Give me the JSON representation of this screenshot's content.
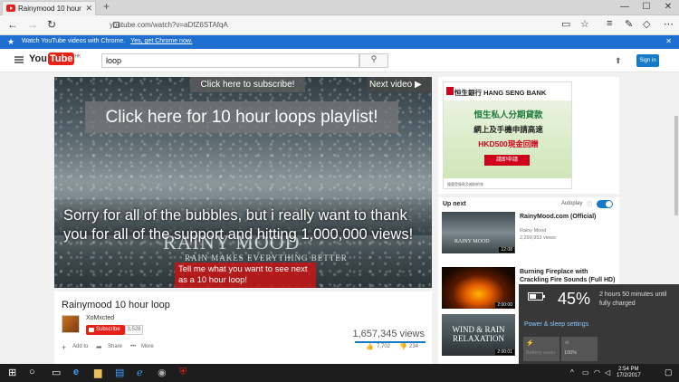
{
  "browser": {
    "tab_title": "Rainymood 10 hour",
    "new_tab": "+",
    "url": "youtube.com/watch?v=aDfZ6STAfqA"
  },
  "infobar": {
    "message": "Watch YouTube videos with Chrome.",
    "link": "Yes, get Chrome now."
  },
  "youtube": {
    "logo_you": "You",
    "logo_tube": "Tube",
    "logo_region": "HK",
    "search_value": "loop",
    "signin": "Sign in"
  },
  "player": {
    "subscribe_annotation": "Click here to subscribe!",
    "next_video_annotation": "Next video ▶",
    "playlist_annotation": "Click here for 10 hour loops playlist!",
    "thanks_text": "Sorry for all of the bubbles, but i really want to thank you for all of the support and hitting 1,000,000 views!",
    "watermark": "RAINY MOOD",
    "watermark_tagline": "RAIN MAKES EVERYTHING BETTER",
    "red_annotation": "Tell me what you want to see next as a 10 hour loop!"
  },
  "video": {
    "title": "Rainymood 10 hour loop",
    "channel": "XoMxcted",
    "subscribe_label": "Subscribe",
    "subscriber_count": "3,528",
    "views": "1,657,345 views",
    "add_to": "Add to",
    "share": "Share",
    "more": "More",
    "likes": "7,702",
    "dislikes": "234"
  },
  "ad": {
    "bank_name": "恒生銀行 HANG SENG BANK",
    "title": "恒生私人分期貸款",
    "line": "網上及手機申請高速",
    "offer": "HKD500現金回贈",
    "cta": "請即申請",
    "footer": "優惠受條款及細則約束"
  },
  "sidebar": {
    "up_next": "Up next",
    "autoplay": "Autoplay",
    "videos": [
      {
        "title": "RainyMood.com (Official)",
        "channel": "Rainy Mood",
        "views": "2,299,953 views",
        "duration": "12:08",
        "thumb_text": "RAINY MOOD"
      },
      {
        "title": "Burning Fireplace with Crackling Fire Sounds (Full HD)",
        "channel": "",
        "views": "",
        "duration": "2:00:00",
        "thumb_text": ""
      },
      {
        "title": "",
        "channel": "",
        "views": "",
        "duration": "2:00:01",
        "thumb_text": "WIND & RAIN RELAXATION"
      }
    ]
  },
  "battery": {
    "percent": "45%",
    "time_remaining": "2 hours 50 minutes until fully charged",
    "settings_link": "Power & sleep settings",
    "tile_saver": "Battery saver",
    "tile_brightness": "100%",
    "level": 0.45
  },
  "taskbar": {
    "time": "2:54 PM",
    "date": "17/2/2017"
  }
}
